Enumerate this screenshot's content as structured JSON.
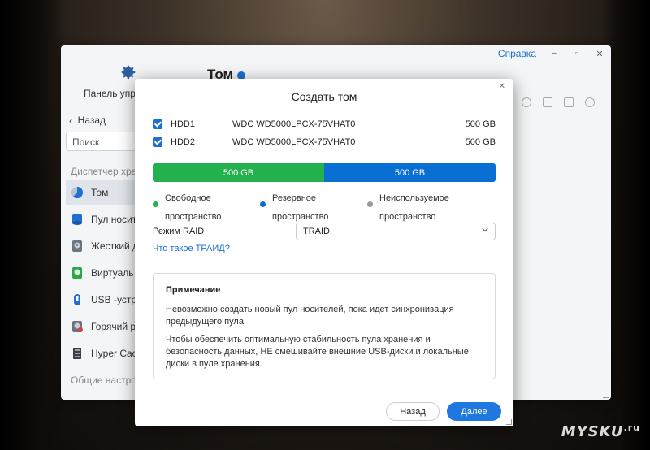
{
  "app": {
    "help_link": "Справка",
    "panel_title": "Панель упр",
    "page_title": "Том",
    "back_label": "Назад",
    "search_placeholder": "Поиск",
    "section_storage": "Диспетчер хра",
    "section_general": "Общие настро",
    "sidebar": [
      {
        "label": "Том",
        "icon": "pie-chart-icon",
        "color": "#1e6fd0",
        "active": true
      },
      {
        "label": "Пул носит",
        "icon": "storage-pool-icon",
        "color": "#1e6fd0"
      },
      {
        "label": "Жесткий д",
        "icon": "hard-disk-icon",
        "color": "#6b7580"
      },
      {
        "label": "Виртуаль",
        "icon": "virtual-disk-icon",
        "color": "#2aa84a"
      },
      {
        "label": "USB -устр",
        "icon": "usb-icon",
        "color": "#1e6fd0"
      },
      {
        "label": "Горячий р",
        "icon": "hot-spare-icon",
        "color": "#6b7580"
      },
      {
        "label": "Hyper Cach",
        "icon": "cache-icon",
        "color": "#3a3f45"
      }
    ]
  },
  "modal": {
    "title": "Создать том",
    "disks": [
      {
        "name": "HDD1",
        "model": "WDC WD5000LPCX-75VHAT0",
        "size": "500 GB",
        "checked": true
      },
      {
        "name": "HDD2",
        "model": "WDC WD5000LPCX-75VHAT0",
        "size": "500 GB",
        "checked": true
      }
    ],
    "bar": {
      "free_label": "500 GB",
      "reserve_label": "500 GB",
      "free_fraction": 0.5,
      "free_color": "#22b14c",
      "reserve_color": "#0a6fd3"
    },
    "legend": [
      {
        "line1": "Свободное",
        "line2": "пространство",
        "color": "#22b14c"
      },
      {
        "line1": "Резервное",
        "line2": "пространство",
        "color": "#0a6fd3"
      },
      {
        "line1": "Неиспользуемое",
        "line2": "пространство",
        "color": "#9a9a9a"
      }
    ],
    "raid_label": "Режим RAID",
    "raid_value": "TRAID",
    "raid_help": "Что такое ТРАИД?",
    "note": {
      "title": "Примечание",
      "text1": "Невозможно создать новый пул носителей, пока идет синхронизация предыдущего пула.",
      "text2": "Чтобы обеспечить оптимальную стабильность пула хранения и безопасность данных, НЕ смешивайте внешние USB-диски и локальные диски в пуле хранения."
    },
    "back_button": "Назад",
    "next_button": "Далее"
  },
  "watermark": {
    "brand": "MYSKU",
    "tld": ".ru"
  }
}
